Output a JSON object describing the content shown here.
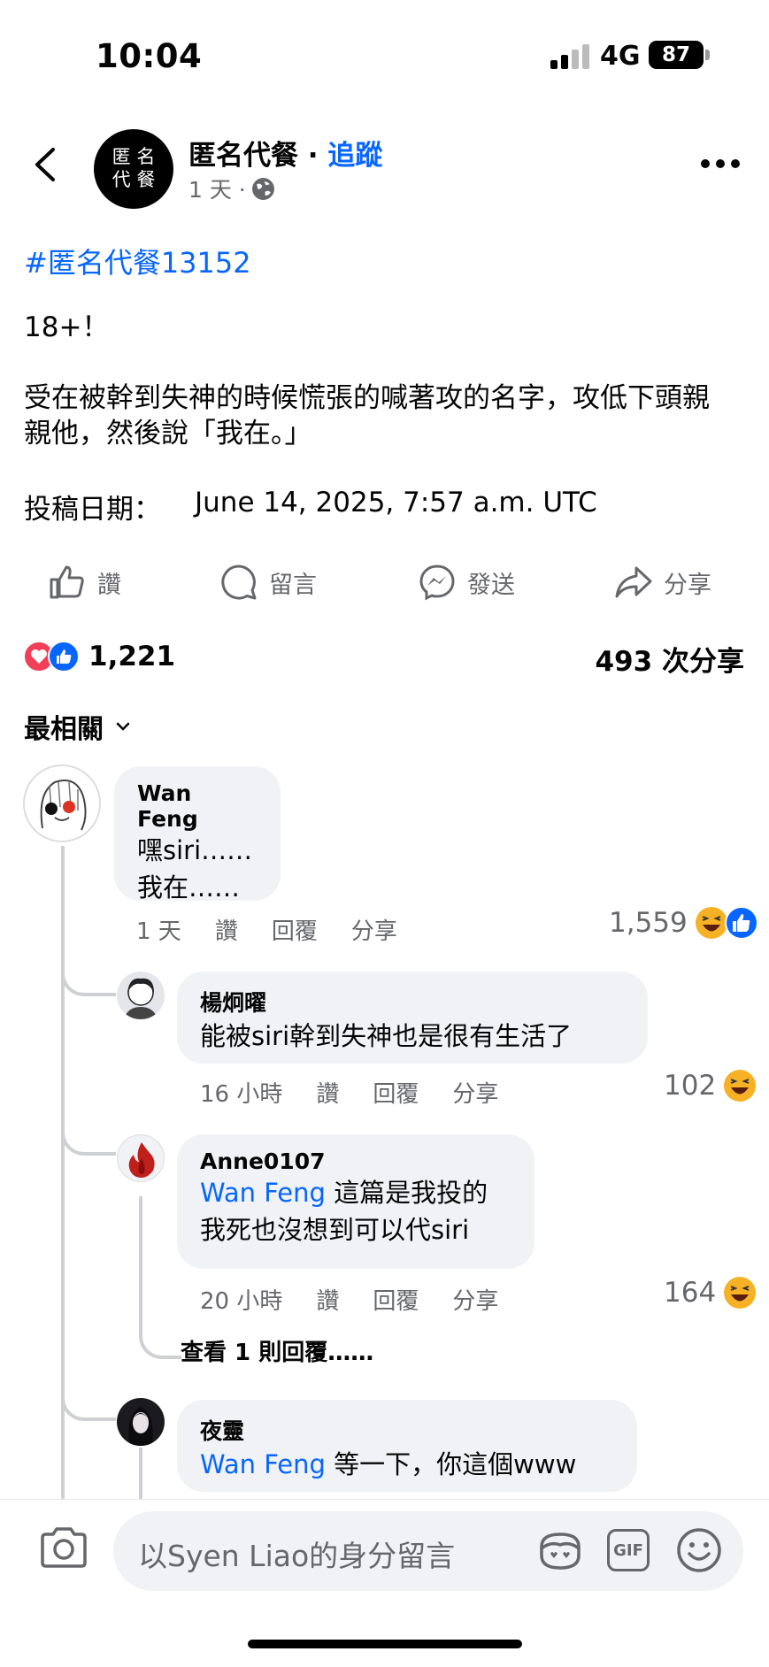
{
  "status_bar": {
    "time": "10:04",
    "network": "4G",
    "battery": "87"
  },
  "post": {
    "page_name": "匿名代餐",
    "separator": " · ",
    "follow_label": "追蹤",
    "time": "1 天 ·",
    "avatar_text_line1": "匿 名",
    "avatar_text_line2": "代 餐",
    "hashtag": "#匿名代餐13152",
    "body": "18+！\n\n受在被幹到失神的時候慌張的喊著攻的名字，攻低下頭親親他，然後說「我在。」",
    "date_label": "投稿日期：",
    "date_value": "June 14, 2025, 7:57 a.m. UTC"
  },
  "actions": {
    "like": "讚",
    "comment": "留言",
    "send": "發送",
    "share": "分享"
  },
  "stats": {
    "reaction_count": "1,221",
    "shares": "493 次分享"
  },
  "sort": {
    "label": "最相關"
  },
  "comments": [
    {
      "name": "Wan Feng",
      "lines": [
        "嘿siri……",
        "我在……"
      ],
      "time": "1 天",
      "like": "讚",
      "reply": "回覆",
      "share": "分享",
      "reactions": "1,559"
    },
    {
      "name": "楊炯曜",
      "mention": "",
      "text": "能被siri幹到失神也是很有生活了",
      "time": "16 小時",
      "like": "讚",
      "reply": "回覆",
      "share": "分享",
      "reactions": "102"
    },
    {
      "name": "Anne0107",
      "mention": "Wan Feng",
      "text": " 這篇是我投的",
      "text2": "我死也沒想到可以代siri",
      "time": "20 小時",
      "like": "讚",
      "reply": "回覆",
      "share": "分享",
      "reactions": "164"
    },
    {
      "name": "夜靈",
      "mention": "Wan Feng",
      "text": " 等一下，你這個www"
    }
  ],
  "view_replies": "查看 1 則回覆……",
  "composer": {
    "placeholder": "以Syen  Liao的身分留言",
    "gif": "GIF"
  },
  "colors": {
    "link": "#0866ff",
    "meta": "#65676b",
    "bubble": "#f0f2f5",
    "love": "#f33e58",
    "like": "#0866ff",
    "haha": "#f7b125"
  }
}
